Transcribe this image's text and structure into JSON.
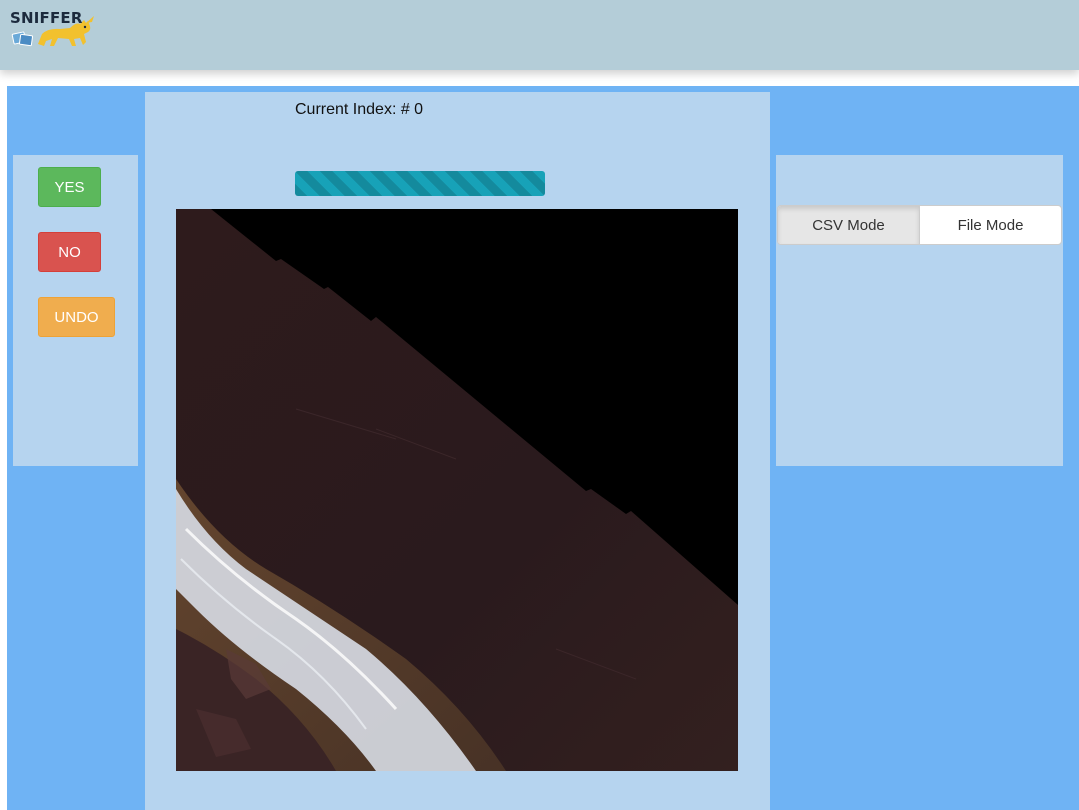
{
  "header": {
    "logo_text": "SNIFFER",
    "logo_icon": "sniffer-dog-icon"
  },
  "controls": {
    "yes_label": "YES",
    "no_label": "NO",
    "undo_label": "UNDO",
    "yes_color": "#5cb85c",
    "no_color": "#d9534f",
    "undo_color": "#f0ad4e"
  },
  "viewer": {
    "index_label": "Current Index: # 0",
    "progress_fraction": 1.0,
    "progress_color": "#17a2b8",
    "image_description": "satellite-tile"
  },
  "mode": {
    "options": [
      "CSV Mode",
      "File Mode"
    ],
    "selected": "CSV Mode"
  },
  "colors": {
    "header_bg": "#b4cdd8",
    "stage_bg": "#6fb3f4",
    "panel_bg": "#b6d4ef"
  }
}
